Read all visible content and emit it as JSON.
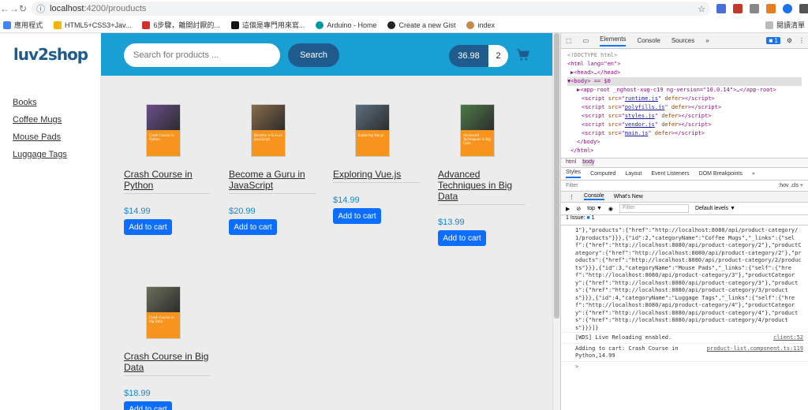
{
  "browser": {
    "url_host": "localhost",
    "url_path": ":4200/prouducts",
    "bookmarks": [
      "應用程式",
      "HTML5+CSS3+Jav...",
      "6步驟，離開討厭的...",
      "這個是專門用來寫...",
      "Arduino - Home",
      "Create a new Gist",
      "index"
    ],
    "reading_list": "閱讀清單"
  },
  "app": {
    "logo": "luv2shop",
    "search_placeholder": "Search for products ...",
    "search_button": "Search",
    "cart_total": "36.98",
    "cart_qty": "2",
    "categories": [
      "Books",
      "Coffee Mugs",
      "Mouse Pads",
      "Luggage Tags"
    ],
    "add_to_cart": "Add to cart",
    "products": [
      {
        "title": "Crash Course in Python",
        "price": "$14.99",
        "cover_text": "Crash Course in Python",
        "cover_color": "#6a4e8c"
      },
      {
        "title": "Become a Guru in JavaScript",
        "price": "$20.99",
        "cover_text": "Become a Guru in JavaScript",
        "cover_color": "#8a6b4a"
      },
      {
        "title": "Exploring Vue.js",
        "price": "$14.99",
        "cover_text": "Exploring Vue.js",
        "cover_color": "#5c6f7e"
      },
      {
        "title": "Advanced Techniques in Big Data",
        "price": "$13.99",
        "cover_text": "Advanced Techniques in Big Data",
        "cover_color": "#4d7a4a"
      },
      {
        "title": "Crash Course in Big Data",
        "price": "$18.99",
        "cover_text": "Crash Course in Big Data",
        "cover_color": "#6b6f5a"
      }
    ]
  },
  "devtools": {
    "tabs": [
      "Elements",
      "Console",
      "Sources"
    ],
    "issue_count": "1",
    "elements": {
      "doctype": "<!DOCTYPE html>",
      "html": "<html lang=\"en\">",
      "head": "▶<head>…</head>",
      "body": "▼<body> == $0",
      "app_root": "▶<app-root _nghost-xug-c19 ng-version=\"10.0.14\">…</app-root>",
      "scripts": [
        "runtime.js",
        "polyfills.js",
        "styles.js",
        "vendor.js",
        "main.js"
      ],
      "body_close": "</body>",
      "html_close": "</html>"
    },
    "breadcrumbs": [
      "html",
      "body"
    ],
    "subtabs": [
      "Styles",
      "Computed",
      "Layout",
      "Event Listeners",
      "DOM Breakpoints"
    ],
    "filter_placeholder": "Filter",
    "filter_hov": ":hov .cls +",
    "console_tabs": [
      "Console",
      "What's New"
    ],
    "context": "top",
    "console_filter": "Filter",
    "levels": "Default levels ▼",
    "issue_text": "1 Issue:",
    "log_text": "1\"},\"products\":{\"href\":\"http://localhost:8080/api/product-category/1/products\"}}},{\"id\":2,\"categoryName\":\"Coffee Mugs\",\"_links\":{\"self\":{\"href\":\"http://localhost:8080/api/product-category/2\"},\"productCategory\":{\"href\":\"http://localhost:8080/api/product-category/2\"},\"products\":{\"href\":\"http://localhost:8080/api/product-category/2/products\"}}},{\"id\":3,\"categoryName\":\"Mouse Pads\",\"_links\":{\"self\":{\"href\":\"http://localhost:8080/api/product-category/3\"},\"productCategory\":{\"href\":\"http://localhost:8080/api/product-category/3\"},\"products\":{\"href\":\"http://localhost:8080/api/product-category/3/products\"}}},{\"id\":4,\"categoryName\":\"Luggage Tags\",\"_links\":{\"self\":{\"href\":\"http://localhost:8080/api/product-category/4\"},\"productCategory\":{\"href\":\"http://localhost:8080/api/product-category/4\"},\"products\":{\"href\":\"http://localhost:8080/api/product-category/4/products\"}}}]}",
    "wds_msg": "[WDS] Live Reloading enabled.",
    "wds_src": "client:52",
    "cart_msg": "Adding to cart: Crash Course in Python,14.99",
    "cart_src": "product-list.component.ts:119"
  }
}
